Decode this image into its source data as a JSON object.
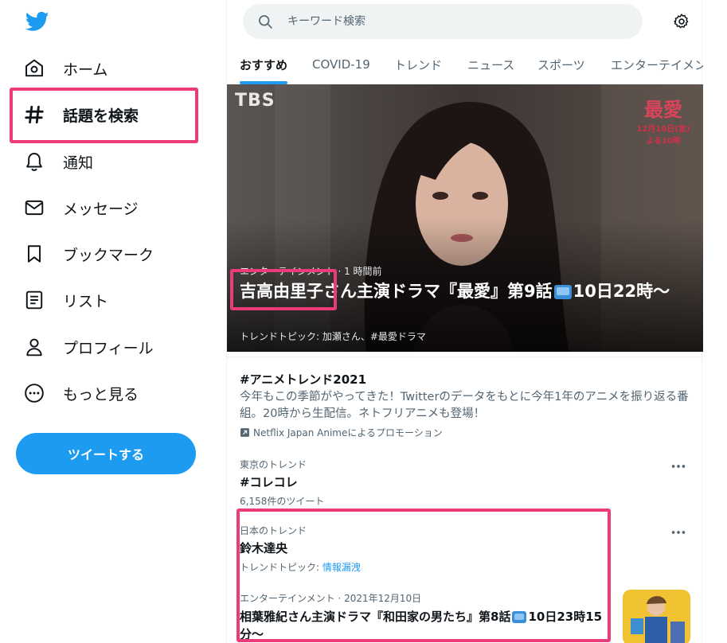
{
  "sidebar": {
    "items": [
      {
        "label": "ホーム",
        "icon": "home-icon"
      },
      {
        "label": "話題を検索",
        "icon": "hashtag-icon"
      },
      {
        "label": "通知",
        "icon": "bell-icon"
      },
      {
        "label": "メッセージ",
        "icon": "envelope-icon"
      },
      {
        "label": "ブックマーク",
        "icon": "bookmark-icon"
      },
      {
        "label": "リスト",
        "icon": "list-icon"
      },
      {
        "label": "プロフィール",
        "icon": "user-icon"
      },
      {
        "label": "もっと見る",
        "icon": "more-circle-icon"
      }
    ],
    "tweet_button": "ツイートする"
  },
  "search": {
    "placeholder": "キーワード検索"
  },
  "tabs": [
    "おすすめ",
    "COVID-19",
    "トレンド",
    "ニュース",
    "スポーツ",
    "エンターテイメン"
  ],
  "hero": {
    "channel_logo": "TBS",
    "promo_title": "最愛",
    "promo_line1": "12月10日(金)",
    "promo_line2": "よる10時",
    "meta": "エンターテインメント · 1 時間前",
    "headline_a": "吉高由里子さん主演ドラマ『最愛』第9話",
    "headline_b": "10日22時〜",
    "topic": "トレンドトピック: 加瀬さん、#最愛ドラマ"
  },
  "trends": [
    {
      "title": "#アニメトレンド2021",
      "description": "今年もこの季節がやってきた！Twitterのデータをもとに今年1年のアニメを振り返る番組。20時から生配信。ネトフリアニメも登場！",
      "promotion": "Netflix Japan Animeによるプロモーション"
    },
    {
      "context": "東京のトレンド",
      "title": "#コレコレ",
      "count": "6,158件のツイート"
    },
    {
      "context": "日本のトレンド",
      "title": "鈴木達央",
      "topic_label": "トレンドトピック:",
      "topic_link": "情報漏洩"
    },
    {
      "context": "エンターテインメント · 2021年12月10日",
      "title_a": "相葉雅紀さん主演ドラマ『和田家の男たち』第8話",
      "title_b": "10日23時15分〜"
    }
  ],
  "colors": {
    "accent": "#1d9bf0",
    "highlight": "#ec3b7a"
  }
}
